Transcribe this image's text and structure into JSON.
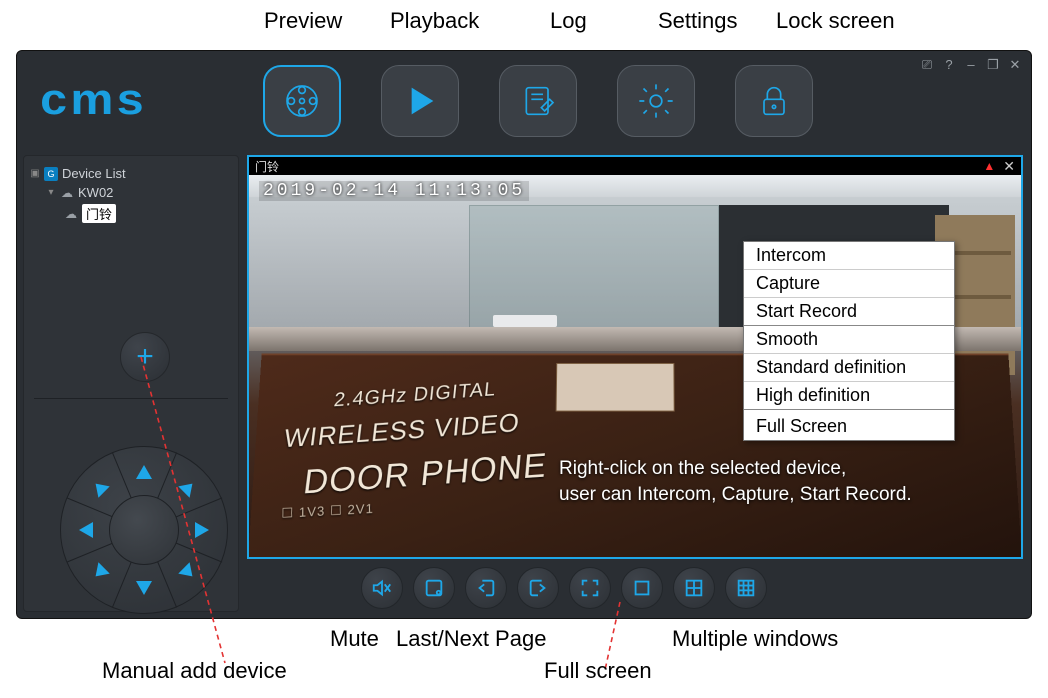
{
  "annotations": {
    "top": {
      "preview": "Preview",
      "playback": "Playback",
      "log": "Log",
      "settings": "Settings",
      "lock": "Lock screen"
    },
    "bottom": {
      "mute": "Mute",
      "page": "Last/Next Page",
      "full": "Full screen",
      "multi": "Multiple windows",
      "addDevice": "Manual add device"
    }
  },
  "app": {
    "logo": "cms",
    "tree": {
      "root": "Device List",
      "rootBadge": "G",
      "node1": "KW02",
      "node2": "门铃"
    },
    "addGlyph": "+",
    "video": {
      "title": "门铃",
      "timestamp": "2019-02-14   11:13:05",
      "closeGlyph": "✕",
      "bellGlyph": "▲",
      "boxText1": "2.4GHz DIGITAL",
      "boxText2": "WIRELESS VIDEO",
      "boxText3": "DOOR PHONE",
      "boxText4": "☐ 1V3   ☐ 2V1",
      "overlay_l1": "Right-click on the selected device,",
      "overlay_l2": "user can Intercom, Capture, Start Record."
    },
    "contextMenu": {
      "i0": "Intercom",
      "i1": "Capture",
      "i2": "Start Record",
      "i3": "Smooth",
      "i4": "Standard definition",
      "i5": "High definition",
      "i6": "Full Screen"
    },
    "winctrl": {
      "monitor": "⎚",
      "help": "?",
      "min": "–",
      "max": "❐",
      "close": "✕"
    }
  }
}
